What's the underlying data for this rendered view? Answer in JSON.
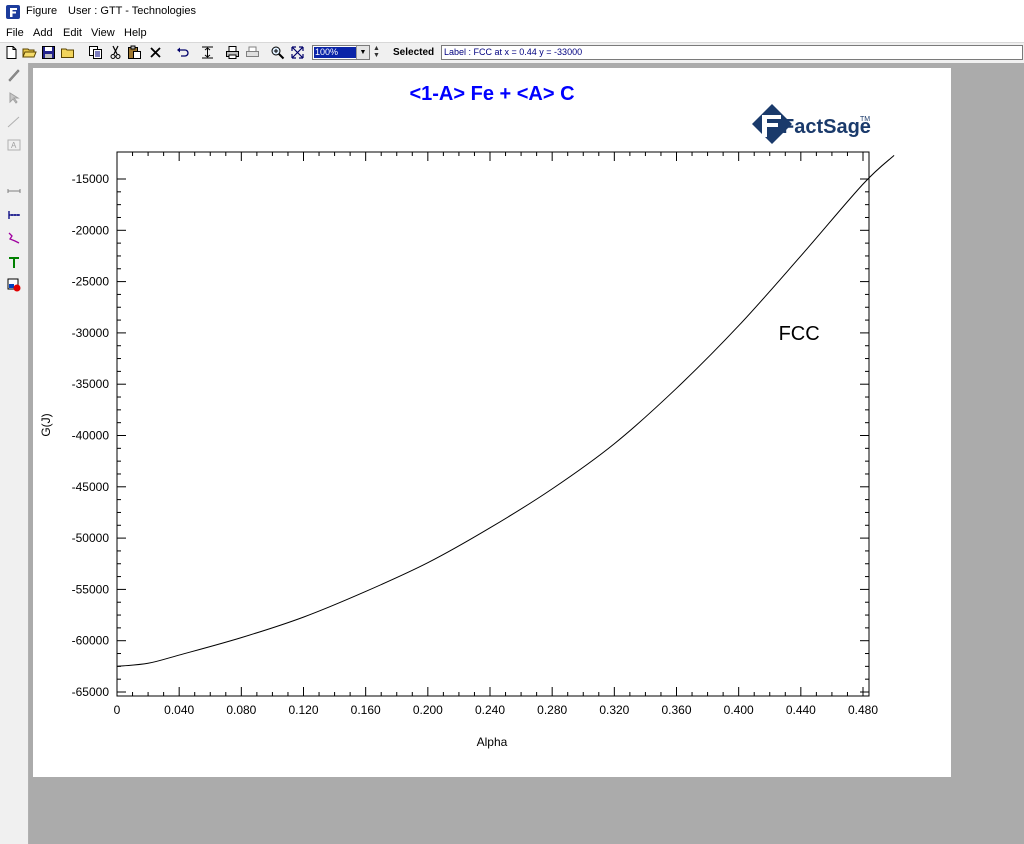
{
  "window": {
    "title": "Figure",
    "user": "User : GTT - Technologies"
  },
  "menu": [
    "File",
    "Add",
    "Edit",
    "View",
    "Help"
  ],
  "toolbar": {
    "zoom_value": "100%",
    "selected_label": "Selected",
    "status_text": "Label : FCC at x = 0.44 y = -33000",
    "buttons": [
      "new-icon",
      "open-icon",
      "save-icon",
      "folder-icon",
      "copy-icon",
      "cut-icon",
      "paste-icon",
      "delete-icon",
      "undo-icon",
      "fit-icon",
      "print-icon",
      "print-preview-icon",
      "zoom-in-icon",
      "zoom-extent-icon"
    ]
  },
  "tools": [
    "pen-icon",
    "pointer-icon",
    "line-icon",
    "text-box-icon",
    "h-line-icon",
    "axis-icon",
    "curve-icon",
    "text-icon",
    "image-icon"
  ],
  "logo": {
    "text": "FactSage",
    "tm": "TM",
    "color": "#1a3a6b"
  },
  "chart_data": {
    "type": "line",
    "title": "<1-A> Fe  +  <A> C",
    "title_color": "#0000ff",
    "xlabel": "Alpha",
    "ylabel": "G(J)",
    "xlim": [
      0,
      0.5
    ],
    "ylim": [
      -65000,
      -12500
    ],
    "xticks": [
      0,
      0.04,
      0.08,
      0.12,
      0.16,
      0.2,
      0.24,
      0.28,
      0.32,
      0.36,
      0.4,
      0.44,
      0.48
    ],
    "xtick_labels": [
      "0",
      "0.040",
      "0.080",
      "0.120",
      "0.160",
      "0.200",
      "0.240",
      "0.280",
      "0.320",
      "0.360",
      "0.400",
      "0.440",
      "0.480"
    ],
    "yticks": [
      -15000,
      -20000,
      -25000,
      -30000,
      -35000,
      -40000,
      -45000,
      -50000,
      -55000,
      -60000,
      -65000
    ],
    "ytick_labels": [
      "-15000",
      "-20000",
      "-25000",
      "-30000",
      "-35000",
      "-40000",
      "-45000",
      "-50000",
      "-55000",
      "-60000",
      "-65000"
    ],
    "grid": false,
    "series": [
      {
        "name": "FCC",
        "x": [
          0,
          0.02,
          0.04,
          0.08,
          0.12,
          0.16,
          0.2,
          0.24,
          0.28,
          0.32,
          0.36,
          0.4,
          0.44,
          0.48,
          0.5
        ],
        "y": [
          -62500,
          -62200,
          -61400,
          -59700,
          -57700,
          -55200,
          -52400,
          -49000,
          -45200,
          -40800,
          -35400,
          -29300,
          -22500,
          -15500,
          -12700
        ]
      }
    ],
    "annotations": [
      {
        "text": "FCC",
        "x": 0.445,
        "y": -30000
      }
    ]
  }
}
